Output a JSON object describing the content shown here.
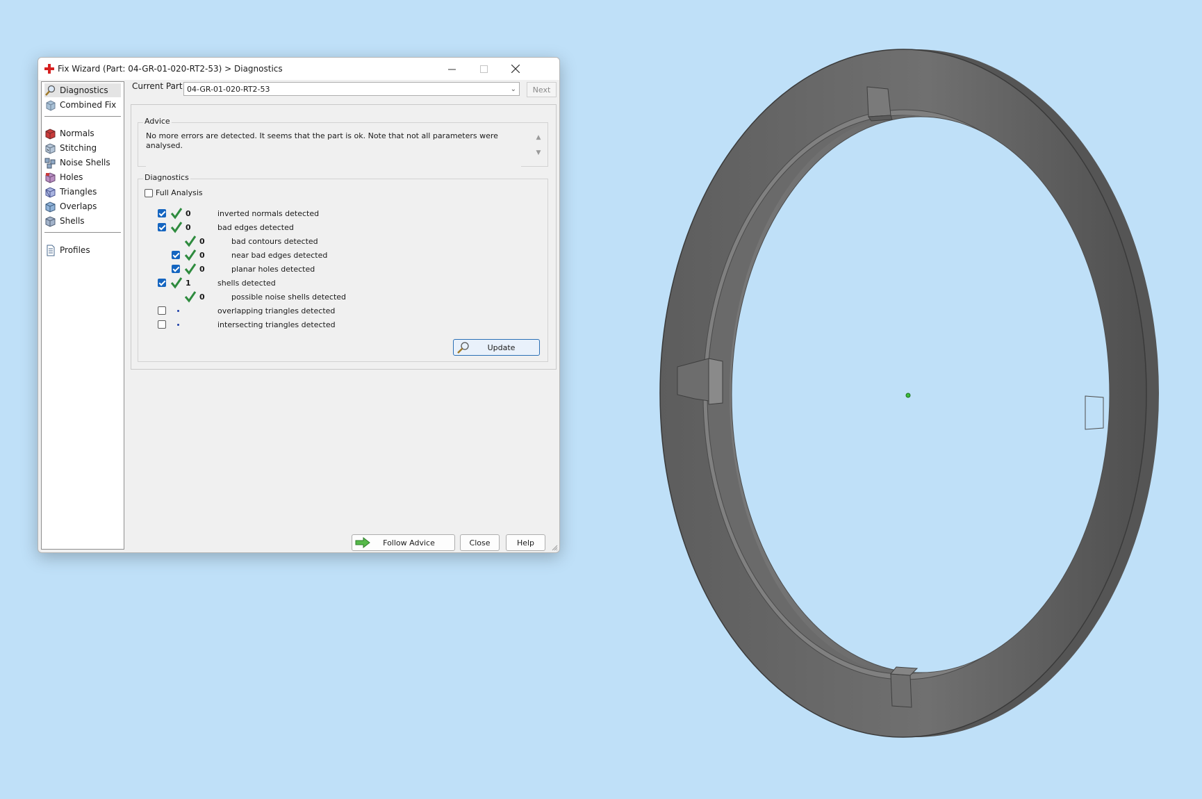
{
  "window": {
    "title": "Fix Wizard (Part: 04-GR-01-020-RT2-53) > Diagnostics"
  },
  "sidebar": {
    "items": [
      {
        "label": "Diagnostics",
        "icon": "diagnostics-icon",
        "selected": true
      },
      {
        "label": "Combined Fix",
        "icon": "combined-fix-icon"
      },
      {
        "label": "Normals",
        "icon": "normals-icon"
      },
      {
        "label": "Stitching",
        "icon": "stitching-icon"
      },
      {
        "label": "Noise Shells",
        "icon": "noise-shells-icon"
      },
      {
        "label": "Holes",
        "icon": "holes-icon"
      },
      {
        "label": "Triangles",
        "icon": "triangles-icon"
      },
      {
        "label": "Overlaps",
        "icon": "overlaps-icon"
      },
      {
        "label": "Shells",
        "icon": "shells-icon"
      },
      {
        "label": "Profiles",
        "icon": "profiles-icon"
      }
    ]
  },
  "current_part": {
    "label": "Current Part:",
    "value": "04-GR-01-020-RT2-53",
    "next_label": "Next"
  },
  "advice": {
    "label": "Advice",
    "text": "No more errors are detected. It seems that the part is ok. Note that not all parameters were analysed."
  },
  "diagnostics": {
    "label": "Diagnostics",
    "full_analysis_label": "Full Analysis",
    "full_analysis_checked": false,
    "rows": [
      {
        "checked": true,
        "status": "ok",
        "count": "0",
        "text": "inverted normals detected",
        "indent": 0
      },
      {
        "checked": true,
        "status": "ok",
        "count": "0",
        "text": "bad edges detected",
        "indent": 0
      },
      {
        "checked": null,
        "status": "ok",
        "count": "0",
        "text": "bad contours detected",
        "indent": 1
      },
      {
        "checked": true,
        "status": "ok",
        "count": "0",
        "text": "near bad edges detected",
        "indent": 1
      },
      {
        "checked": true,
        "status": "ok",
        "count": "0",
        "text": "planar holes detected",
        "indent": 1
      },
      {
        "checked": true,
        "status": "ok",
        "count": "1",
        "text": "shells detected",
        "indent": 0
      },
      {
        "checked": null,
        "status": "ok",
        "count": "0",
        "text": "possible noise shells detected",
        "indent": 1
      },
      {
        "checked": false,
        "status": "pending",
        "count": "",
        "text": "overlapping triangles detected",
        "indent": 0
      },
      {
        "checked": false,
        "status": "pending",
        "count": "",
        "text": "intersecting triangles detected",
        "indent": 0
      }
    ],
    "update_label": "Update"
  },
  "footer": {
    "follow_advice_label": "Follow Advice",
    "close_label": "Close",
    "help_label": "Help"
  },
  "colors": {
    "desktop": "#bfe0f8",
    "check_green": "#2e8b3e",
    "checkbox_blue": "#1565c0",
    "part_gray": "#6f6f6f"
  }
}
